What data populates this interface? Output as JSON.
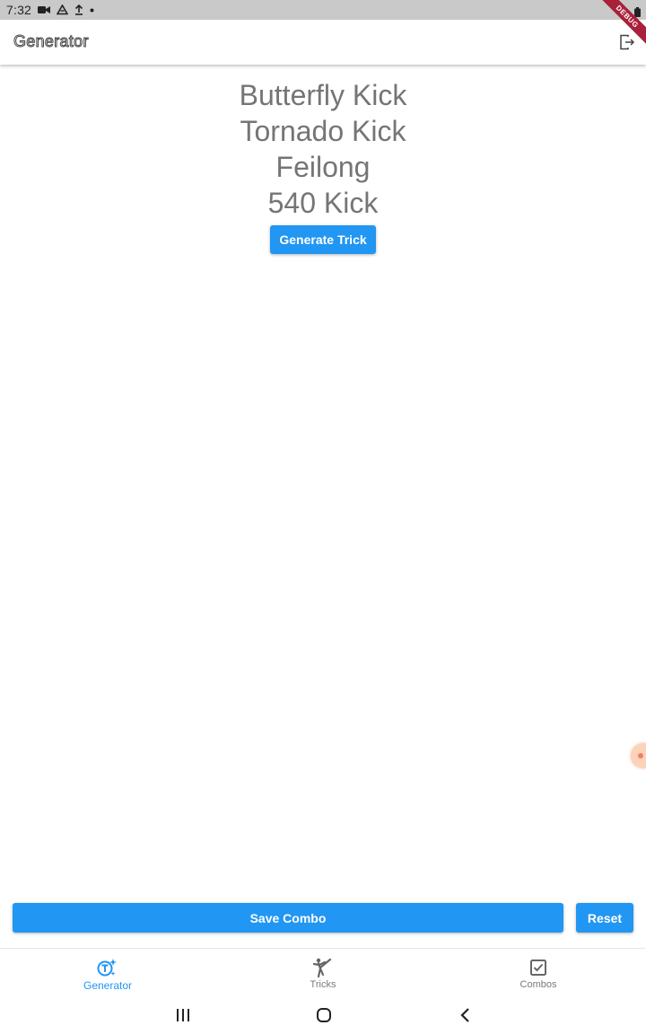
{
  "status_bar": {
    "time": "7:32"
  },
  "debug_banner": "DEBUG",
  "app_bar": {
    "title": "Generator"
  },
  "tricks": [
    "Butterfly Kick",
    "Tornado Kick",
    "Feilong",
    "540 Kick"
  ],
  "actions": {
    "generate_label": "Generate Trick",
    "save_combo_label": "Save Combo",
    "reset_label": "Reset"
  },
  "bottom_nav": {
    "items": [
      {
        "label": "Generator",
        "icon": "generator-icon",
        "active": true
      },
      {
        "label": "Tricks",
        "icon": "kick-icon",
        "active": false
      },
      {
        "label": "Combos",
        "icon": "checkbox-icon",
        "active": false
      }
    ]
  },
  "colors": {
    "primary": "#2196f3",
    "trick_text": "#757575",
    "status_bar": "#c9c9c9",
    "debug_ribbon": "#a8203a"
  }
}
